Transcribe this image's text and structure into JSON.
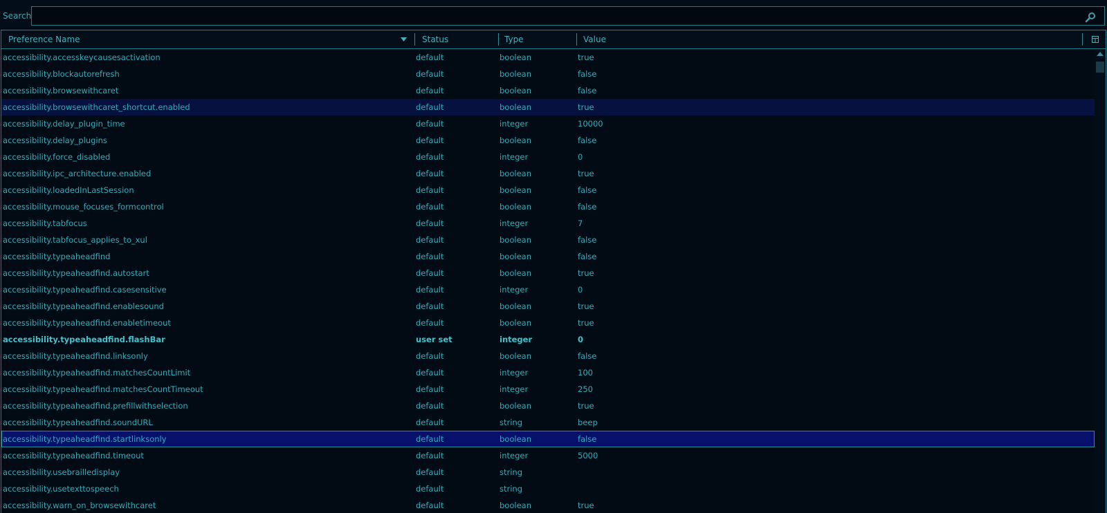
{
  "search": {
    "label": "Search:",
    "value": "",
    "placeholder": ""
  },
  "columns": {
    "name": "Preference Name",
    "status": "Status",
    "type": "Type",
    "value": "Value"
  },
  "colors": {
    "background": "#020b14",
    "text": "#2fb1bd",
    "border": "#1f7f8d",
    "selected": "#061140",
    "current": "#07106b"
  },
  "icons": {
    "search": "search-icon",
    "sort": "sort-descending-icon",
    "column_picker": "column-picker-icon"
  },
  "rows": [
    {
      "name": "accessibility.accesskeycausesactivation",
      "status": "default",
      "type": "boolean",
      "value": "true"
    },
    {
      "name": "accessibility.blockautorefresh",
      "status": "default",
      "type": "boolean",
      "value": "false"
    },
    {
      "name": "accessibility.browsewithcaret",
      "status": "default",
      "type": "boolean",
      "value": "false"
    },
    {
      "name": "accessibility.browsewithcaret_shortcut.enabled",
      "status": "default",
      "type": "boolean",
      "value": "true",
      "state": "sel"
    },
    {
      "name": "accessibility.delay_plugin_time",
      "status": "default",
      "type": "integer",
      "value": "10000"
    },
    {
      "name": "accessibility.delay_plugins",
      "status": "default",
      "type": "boolean",
      "value": "false"
    },
    {
      "name": "accessibility.force_disabled",
      "status": "default",
      "type": "integer",
      "value": "0"
    },
    {
      "name": "accessibility.ipc_architecture.enabled",
      "status": "default",
      "type": "boolean",
      "value": "true"
    },
    {
      "name": "accessibility.loadedInLastSession",
      "status": "default",
      "type": "boolean",
      "value": "false"
    },
    {
      "name": "accessibility.mouse_focuses_formcontrol",
      "status": "default",
      "type": "boolean",
      "value": "false"
    },
    {
      "name": "accessibility.tabfocus",
      "status": "default",
      "type": "integer",
      "value": "7"
    },
    {
      "name": "accessibility.tabfocus_applies_to_xul",
      "status": "default",
      "type": "boolean",
      "value": "false"
    },
    {
      "name": "accessibility.typeaheadfind",
      "status": "default",
      "type": "boolean",
      "value": "false"
    },
    {
      "name": "accessibility.typeaheadfind.autostart",
      "status": "default",
      "type": "boolean",
      "value": "true"
    },
    {
      "name": "accessibility.typeaheadfind.casesensitive",
      "status": "default",
      "type": "integer",
      "value": "0"
    },
    {
      "name": "accessibility.typeaheadfind.enablesound",
      "status": "default",
      "type": "boolean",
      "value": "true"
    },
    {
      "name": "accessibility.typeaheadfind.enabletimeout",
      "status": "default",
      "type": "boolean",
      "value": "true"
    },
    {
      "name": "accessibility.typeaheadfind.flashBar",
      "status": "user set",
      "type": "integer",
      "value": "0",
      "state": "bold"
    },
    {
      "name": "accessibility.typeaheadfind.linksonly",
      "status": "default",
      "type": "boolean",
      "value": "false"
    },
    {
      "name": "accessibility.typeaheadfind.matchesCountLimit",
      "status": "default",
      "type": "integer",
      "value": "100"
    },
    {
      "name": "accessibility.typeaheadfind.matchesCountTimeout",
      "status": "default",
      "type": "integer",
      "value": "250"
    },
    {
      "name": "accessibility.typeaheadfind.prefillwithselection",
      "status": "default",
      "type": "boolean",
      "value": "true"
    },
    {
      "name": "accessibility.typeaheadfind.soundURL",
      "status": "default",
      "type": "string",
      "value": "beep"
    },
    {
      "name": "accessibility.typeaheadfind.startlinksonly",
      "status": "default",
      "type": "boolean",
      "value": "false",
      "state": "cur"
    },
    {
      "name": "accessibility.typeaheadfind.timeout",
      "status": "default",
      "type": "integer",
      "value": "5000"
    },
    {
      "name": "accessibility.usebrailledisplay",
      "status": "default",
      "type": "string",
      "value": ""
    },
    {
      "name": "accessibility.usetexttospeech",
      "status": "default",
      "type": "string",
      "value": ""
    },
    {
      "name": "accessibility.warn_on_browsewithcaret",
      "status": "default",
      "type": "boolean",
      "value": "true"
    }
  ]
}
